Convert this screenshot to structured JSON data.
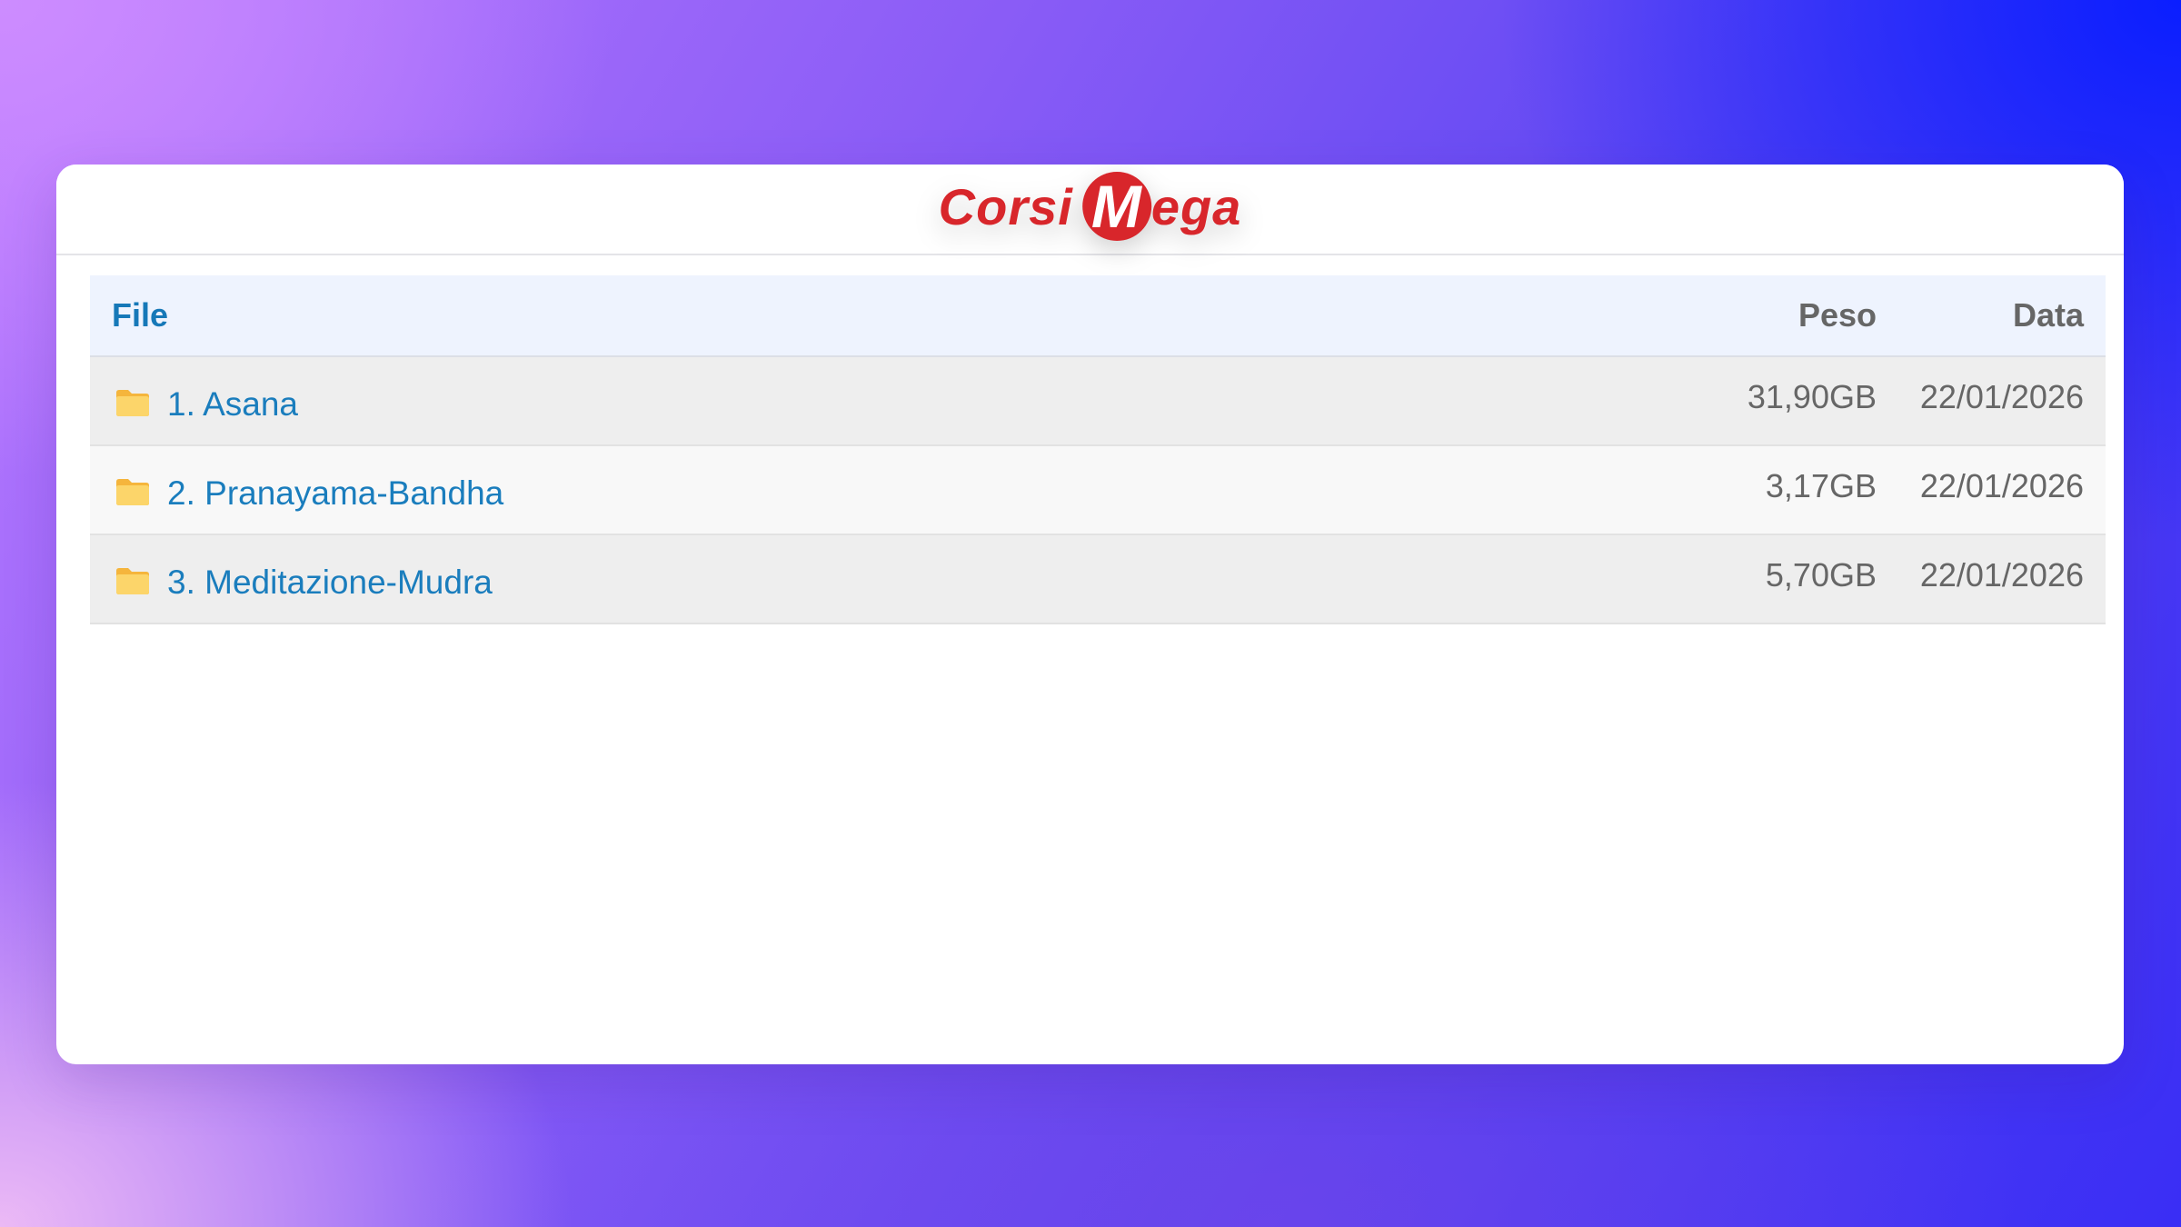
{
  "brand": {
    "logo_text_a": "Corsi",
    "logo_letter": "M",
    "logo_text_b": "ega",
    "color": "#d8262b"
  },
  "table": {
    "headers": {
      "file": "File",
      "size": "Peso",
      "date": "Data"
    },
    "rows": [
      {
        "icon": "folder-icon",
        "name": "1. Asana",
        "size": "31,90GB",
        "date": "22/01/2026"
      },
      {
        "icon": "folder-icon",
        "name": "2. Pranayama-Bandha",
        "size": "3,17GB",
        "date": "22/01/2026"
      },
      {
        "icon": "folder-icon",
        "name": "3. Meditazione-Mudra",
        "size": "5,70GB",
        "date": "22/01/2026"
      }
    ],
    "link_color": "#1a7dbd",
    "folder_color": "#fbc957"
  }
}
